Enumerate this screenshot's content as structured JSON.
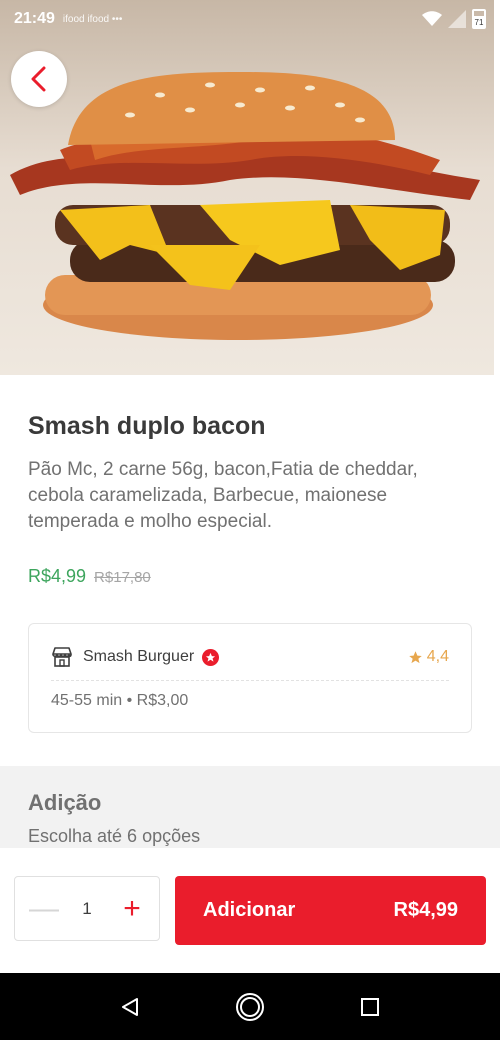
{
  "status_bar": {
    "time": "21:49",
    "notifications": "ifood ifood •••",
    "battery": "71"
  },
  "product": {
    "name": "Smash duplo bacon",
    "description": "Pão Mc, 2 carne 56g, bacon,Fatia de cheddar, cebola caramelizada, Barbecue, maionese temperada e molho especial.",
    "price": "R$4,99",
    "old_price": "R$17,80",
    "image_alt": "burger-photo"
  },
  "store": {
    "name": "Smash Burguer",
    "rating": "4,4",
    "delivery_info": "45-55 min • R$3,00"
  },
  "addons": {
    "title": "Adição",
    "subtitle": "Escolha até 6 opções"
  },
  "cart": {
    "quantity": "1",
    "add_label": "Adicionar",
    "total": "R$4,99"
  },
  "colors": {
    "brand_red": "#ea1d2c",
    "price_green": "#3da55d",
    "rating_gold": "#e7a74e"
  },
  "icons": {
    "back": "chevron-left-icon",
    "store": "store-icon",
    "super": "star-badge-icon",
    "rating": "star-icon",
    "nav": [
      "back-triangle-icon",
      "home-circle-icon",
      "recents-square-icon"
    ]
  }
}
